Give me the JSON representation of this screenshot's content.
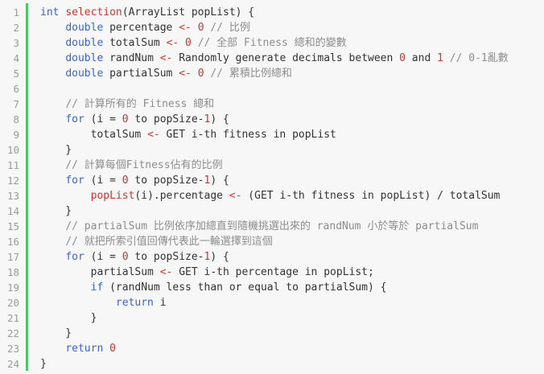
{
  "colors": {
    "background": "#f7f7f7",
    "accent_bar": "#4fc764",
    "keyword": "#3a64c8",
    "highlight": "#c9372c",
    "comment": "#8d8d8d",
    "line_number": "#9b9b9b"
  },
  "lines": [
    {
      "num": "1",
      "tokens": [
        {
          "t": "int",
          "c": "kw"
        },
        {
          "t": " ",
          "c": "pl"
        },
        {
          "t": "selection",
          "c": "red"
        },
        {
          "t": "(ArrayList popList) {",
          "c": "pl"
        }
      ]
    },
    {
      "num": "2",
      "tokens": [
        {
          "t": "    ",
          "c": "pl"
        },
        {
          "t": "double",
          "c": "kw"
        },
        {
          "t": " percentage ",
          "c": "pl"
        },
        {
          "t": "<-",
          "c": "red"
        },
        {
          "t": " ",
          "c": "pl"
        },
        {
          "t": "0",
          "c": "red"
        },
        {
          "t": " // 比例",
          "c": "cm"
        }
      ]
    },
    {
      "num": "3",
      "tokens": [
        {
          "t": "    ",
          "c": "pl"
        },
        {
          "t": "double",
          "c": "kw"
        },
        {
          "t": " totalSum ",
          "c": "pl"
        },
        {
          "t": "<-",
          "c": "red"
        },
        {
          "t": " ",
          "c": "pl"
        },
        {
          "t": "0",
          "c": "red"
        },
        {
          "t": " // 全部 Fitness 總和的變數",
          "c": "cm"
        }
      ]
    },
    {
      "num": "4",
      "tokens": [
        {
          "t": "    ",
          "c": "pl"
        },
        {
          "t": "double",
          "c": "kw"
        },
        {
          "t": " randNum ",
          "c": "pl"
        },
        {
          "t": "<-",
          "c": "red"
        },
        {
          "t": " Randomly generate decimals between ",
          "c": "pl"
        },
        {
          "t": "0",
          "c": "red"
        },
        {
          "t": " and ",
          "c": "pl"
        },
        {
          "t": "1",
          "c": "red"
        },
        {
          "t": " // 0-1亂數",
          "c": "cm"
        }
      ]
    },
    {
      "num": "5",
      "tokens": [
        {
          "t": "    ",
          "c": "pl"
        },
        {
          "t": "double",
          "c": "kw"
        },
        {
          "t": " partialSum ",
          "c": "pl"
        },
        {
          "t": "<-",
          "c": "red"
        },
        {
          "t": " ",
          "c": "pl"
        },
        {
          "t": "0",
          "c": "red"
        },
        {
          "t": " // 累積比例總和",
          "c": "cm"
        }
      ]
    },
    {
      "num": "6",
      "tokens": []
    },
    {
      "num": "7",
      "tokens": [
        {
          "t": "    ",
          "c": "pl"
        },
        {
          "t": "// 計算所有的 Fitness 總和",
          "c": "cm"
        }
      ]
    },
    {
      "num": "8",
      "tokens": [
        {
          "t": "    ",
          "c": "pl"
        },
        {
          "t": "for",
          "c": "kw"
        },
        {
          "t": " (i = ",
          "c": "pl"
        },
        {
          "t": "0",
          "c": "red"
        },
        {
          "t": " to popSize-",
          "c": "pl"
        },
        {
          "t": "1",
          "c": "red"
        },
        {
          "t": ") {",
          "c": "pl"
        }
      ]
    },
    {
      "num": "9",
      "tokens": [
        {
          "t": "        totalSum ",
          "c": "pl"
        },
        {
          "t": "<-",
          "c": "red"
        },
        {
          "t": " GET i-th fitness in popList",
          "c": "pl"
        }
      ]
    },
    {
      "num": "10",
      "tokens": [
        {
          "t": "    }",
          "c": "pl"
        }
      ]
    },
    {
      "num": "11",
      "tokens": [
        {
          "t": "    ",
          "c": "pl"
        },
        {
          "t": "// 計算每個Fitness佔有的比例",
          "c": "cm"
        }
      ]
    },
    {
      "num": "12",
      "tokens": [
        {
          "t": "    ",
          "c": "pl"
        },
        {
          "t": "for",
          "c": "kw"
        },
        {
          "t": " (i = ",
          "c": "pl"
        },
        {
          "t": "0",
          "c": "red"
        },
        {
          "t": " to popSize-",
          "c": "pl"
        },
        {
          "t": "1",
          "c": "red"
        },
        {
          "t": ") {",
          "c": "pl"
        }
      ]
    },
    {
      "num": "13",
      "tokens": [
        {
          "t": "        ",
          "c": "pl"
        },
        {
          "t": "popList",
          "c": "red"
        },
        {
          "t": "(i).percentage ",
          "c": "pl"
        },
        {
          "t": "<-",
          "c": "red"
        },
        {
          "t": " (GET i-th fitness in popList) / totalSum",
          "c": "pl"
        }
      ]
    },
    {
      "num": "14",
      "tokens": [
        {
          "t": "    }",
          "c": "pl"
        }
      ]
    },
    {
      "num": "15",
      "tokens": [
        {
          "t": "    ",
          "c": "pl"
        },
        {
          "t": "// partialSum 比例依序加總直到隨機挑選出來的 randNum 小於等於 partialSum",
          "c": "cm"
        }
      ]
    },
    {
      "num": "16",
      "tokens": [
        {
          "t": "    ",
          "c": "pl"
        },
        {
          "t": "// 就把所索引值回傳代表此一輪選擇到這個",
          "c": "cm"
        }
      ]
    },
    {
      "num": "17",
      "tokens": [
        {
          "t": "    ",
          "c": "pl"
        },
        {
          "t": "for",
          "c": "kw"
        },
        {
          "t": " (i = ",
          "c": "pl"
        },
        {
          "t": "0",
          "c": "red"
        },
        {
          "t": " to popSize-",
          "c": "pl"
        },
        {
          "t": "1",
          "c": "red"
        },
        {
          "t": ") {",
          "c": "pl"
        }
      ]
    },
    {
      "num": "18",
      "tokens": [
        {
          "t": "        partialSum ",
          "c": "pl"
        },
        {
          "t": "<-",
          "c": "red"
        },
        {
          "t": " GET i-th percentage in popList;",
          "c": "pl"
        }
      ]
    },
    {
      "num": "19",
      "tokens": [
        {
          "t": "        ",
          "c": "pl"
        },
        {
          "t": "if",
          "c": "kw"
        },
        {
          "t": " (randNum less than or equal to partialSum) {",
          "c": "pl"
        }
      ]
    },
    {
      "num": "20",
      "tokens": [
        {
          "t": "            ",
          "c": "pl"
        },
        {
          "t": "return",
          "c": "kw"
        },
        {
          "t": " i",
          "c": "pl"
        }
      ]
    },
    {
      "num": "21",
      "tokens": [
        {
          "t": "        }",
          "c": "pl"
        }
      ]
    },
    {
      "num": "22",
      "tokens": [
        {
          "t": "    }",
          "c": "pl"
        }
      ]
    },
    {
      "num": "23",
      "tokens": [
        {
          "t": "    ",
          "c": "pl"
        },
        {
          "t": "return",
          "c": "kw"
        },
        {
          "t": " ",
          "c": "pl"
        },
        {
          "t": "0",
          "c": "red"
        }
      ]
    },
    {
      "num": "24",
      "tokens": [
        {
          "t": "}",
          "c": "pl"
        }
      ]
    }
  ]
}
